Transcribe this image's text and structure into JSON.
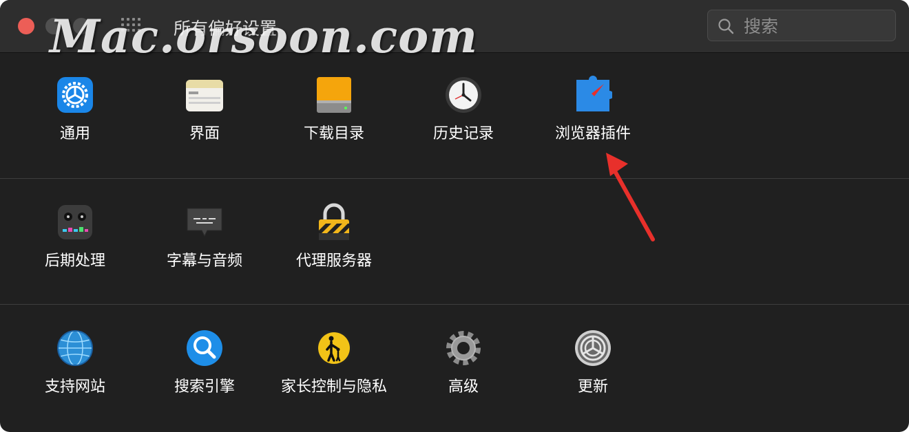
{
  "window": {
    "title": "所有偏好设置",
    "watermark": "Mac.orsoon.com"
  },
  "search": {
    "placeholder": "搜索",
    "icon": "magnifier-icon"
  },
  "rows": [
    [
      {
        "label": "通用",
        "icon": "general-gear-icon"
      },
      {
        "label": "界面",
        "icon": "interface-window-icon"
      },
      {
        "label": "下载目录",
        "icon": "downloads-drive-icon"
      },
      {
        "label": "历史记录",
        "icon": "history-clock-icon"
      },
      {
        "label": "浏览器插件",
        "icon": "browser-extension-compass-icon"
      }
    ],
    [
      {
        "label": "后期处理",
        "icon": "post-processing-mixer-icon"
      },
      {
        "label": "字幕与音频",
        "icon": "subtitles-audio-bubble-icon"
      },
      {
        "label": "代理服务器",
        "icon": "proxy-lock-icon"
      }
    ],
    [
      {
        "label": "支持网站",
        "icon": "support-globe-icon"
      },
      {
        "label": "搜索引擎",
        "icon": "search-engine-icon"
      },
      {
        "label": "家长控制与隐私",
        "icon": "parental-controls-icon"
      },
      {
        "label": "高级",
        "icon": "advanced-gear-icon"
      },
      {
        "label": "更新",
        "icon": "update-icon"
      }
    ]
  ],
  "colors": {
    "close_light": "#ec5e57",
    "annotation_arrow": "#e8302b"
  }
}
